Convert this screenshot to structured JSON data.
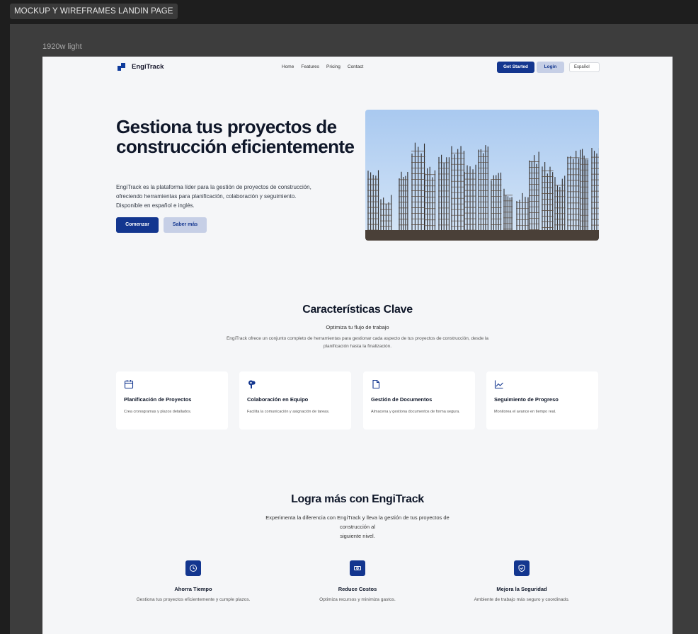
{
  "editor": {
    "page_tab": "MOCKUP Y WIREFRAMES LANDIN PAGE",
    "frame_label": "1920w light"
  },
  "nav": {
    "brand": "EngiTrack",
    "links": [
      "Home",
      "Features",
      "Pricing",
      "Contact"
    ],
    "get_started": "Get Started",
    "login": "Login",
    "language": "Español"
  },
  "hero": {
    "title": "Gestiona tus proyectos de construcción eficientemente",
    "description": "EngiTrack es la plataforma líder para la gestión de proyectos de construcción, ofreciendo herramientas para planificación, colaboración y seguimiento. Disponible en español e inglés.",
    "primary_button": "Comenzar",
    "secondary_button": "Saber más"
  },
  "features": {
    "title": "Características Clave",
    "subtitle": "Optimiza tu flujo de trabajo",
    "description": "EngiTrack ofrece un conjunto completo de herramientas para gestionar cada aspecto de tus proyectos de construcción, desde la planificación hasta la finalización.",
    "cards": [
      {
        "icon": "calendar-icon",
        "title": "Planificación de Proyectos",
        "desc": "Crea cronogramas y plazos detallados."
      },
      {
        "icon": "team-icon",
        "title": "Colaboración en Equipo",
        "desc": "Facilita la comunicación y asignación de tareas."
      },
      {
        "icon": "document-icon",
        "title": "Gestión de Documentos",
        "desc": "Almacena y gestiona documentos de forma segura."
      },
      {
        "icon": "chart-line-icon",
        "title": "Seguimiento de Progreso",
        "desc": "Monitorea el avance en tiempo real."
      }
    ]
  },
  "benefits": {
    "title": "Logra más con EngiTrack",
    "description_lines": [
      "Experimenta la diferencia con EngiTrack y lleva la gestión de tus proyectos de",
      "construcción al",
      "siguiente nivel."
    ],
    "items": [
      {
        "icon": "clock-icon",
        "title": "Ahorra Tiempo",
        "desc": "Gestiona tus proyectos eficientemente y cumple plazos."
      },
      {
        "icon": "money-icon",
        "title": "Reduce Costos",
        "desc": "Optimiza recursos y minimiza gastos."
      },
      {
        "icon": "shield-icon",
        "title": "Mejora la Seguridad",
        "desc": "Ambiente de trabajo más seguro y coordinado."
      }
    ]
  },
  "colors": {
    "primary": "#13368f",
    "secondary": "#c6cfe6",
    "background": "#f5f6f8"
  }
}
